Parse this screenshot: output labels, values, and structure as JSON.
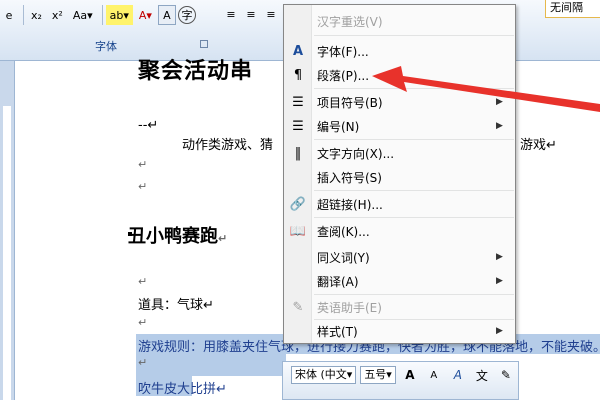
{
  "ribbon": {
    "font_buttons": [
      "e",
      "x₂",
      "x²",
      "Aa▾",
      "ab▾",
      "A▾",
      "A",
      "字"
    ],
    "group_label": "字体",
    "para_buttons": [
      "≡",
      "≡",
      "≡"
    ],
    "style_box": "无间隔"
  },
  "document": {
    "heading_top": "聚会活动串",
    "dash_line": "--↵",
    "body_line_left": "动作类游戏、猜",
    "body_line_right": "游戏↵",
    "para_mark": "↵",
    "heading2": "丑小鸭赛跑",
    "heading2_mark": "↵",
    "props_line": "道具：气球↵",
    "rules_line": "游戏规则：用膝盖夹住气球，进行接力赛跑，快者为胜，球不能落地，不能夹破。↵",
    "last_line": "吹牛皮大比拼↵"
  },
  "context_menu": {
    "items": [
      {
        "label": "汉字重选(V)",
        "icon": "",
        "submenu": false,
        "disabled": true
      },
      {
        "label": "字体(F)...",
        "icon": "A",
        "submenu": false,
        "disabled": false
      },
      {
        "label": "段落(P)...",
        "icon": "¶",
        "submenu": false,
        "disabled": false
      },
      {
        "label": "项目符号(B)",
        "icon": "☰",
        "submenu": true,
        "disabled": false
      },
      {
        "label": "编号(N)",
        "icon": "☰",
        "submenu": true,
        "disabled": false
      },
      {
        "label": "文字方向(X)...",
        "icon": "‖",
        "submenu": false,
        "disabled": false
      },
      {
        "label": "插入符号(S)",
        "icon": "",
        "submenu": false,
        "disabled": false
      },
      {
        "label": "超链接(H)...",
        "icon": "🔗",
        "submenu": false,
        "disabled": false
      },
      {
        "label": "查阅(K)...",
        "icon": "📖",
        "submenu": false,
        "disabled": false
      },
      {
        "label": "同义词(Y)",
        "icon": "",
        "submenu": true,
        "disabled": false
      },
      {
        "label": "翻译(A)",
        "icon": "",
        "submenu": true,
        "disabled": false
      },
      {
        "label": "英语助手(E)",
        "icon": "✎",
        "submenu": false,
        "disabled": true
      },
      {
        "label": "样式(T)",
        "icon": "",
        "submenu": true,
        "disabled": false
      }
    ]
  },
  "mini_toolbar": {
    "font_name": "宋体 (中文▾",
    "font_size": "五号▾",
    "grow_font": "A",
    "shrink_font": "A",
    "style_button": "A",
    "phonetic": "文",
    "format_painter": "✎"
  },
  "colors": {
    "ribbon_label": "#15428b",
    "selection": "#b5cce8",
    "arrow": "#e8322b"
  }
}
